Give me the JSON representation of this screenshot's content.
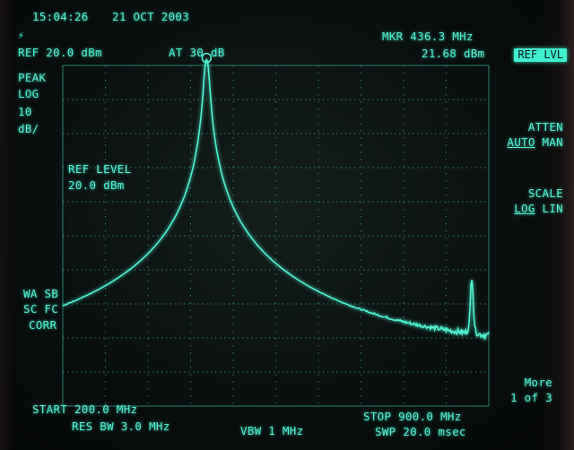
{
  "header": {
    "time": "15:04:26",
    "date": "21 OCT 2003",
    "logo_icon": "agilent-spark-icon",
    "ref_level": "REF 20.0 dBm",
    "attenuation": "AT 30 dB",
    "marker_freq": "MKR 436.3 MHz",
    "marker_level": "21.68 dBm"
  },
  "left_annotations": {
    "detector": "PEAK",
    "scale_type": "LOG",
    "scale_value": "10",
    "scale_unit": "dB/",
    "correction_lines": [
      "WA SB",
      "SC FC",
      "CORR"
    ]
  },
  "active_function": {
    "label": "REF LEVEL",
    "value": "20.0 dBm"
  },
  "softkeys": {
    "ref_lvl": "REF LVL",
    "atten_title": "ATTEN",
    "atten_auto": "AUTO",
    "atten_man": "MAN",
    "scale_title": "SCALE",
    "scale_log": "LOG",
    "scale_lin": "LIN",
    "more": "More",
    "page": "1 of 3"
  },
  "footer": {
    "start": "START 200.0 MHz",
    "stop": "STOP 900.0 MHz",
    "res_bw": "RES BW 3.0 MHz",
    "vbw": "VBW 1 MHz",
    "sweep": "SWP 20.0 msec"
  },
  "colors": {
    "trace": "#4ff2d2",
    "graticule": "#3fd8b8",
    "background": "#0d1514"
  },
  "spectrum": {
    "start_mhz": 200.0,
    "stop_mhz": 900.0,
    "ref_dbm": 20.0,
    "db_per_div": 10,
    "divisions": 10,
    "peaks": [
      {
        "freq_mhz": 436.3,
        "level_dbm": 21.68
      },
      {
        "freq_mhz": 872.0,
        "level_dbm": -43.0
      }
    ],
    "noise_floor_dbm": -62.0
  }
}
